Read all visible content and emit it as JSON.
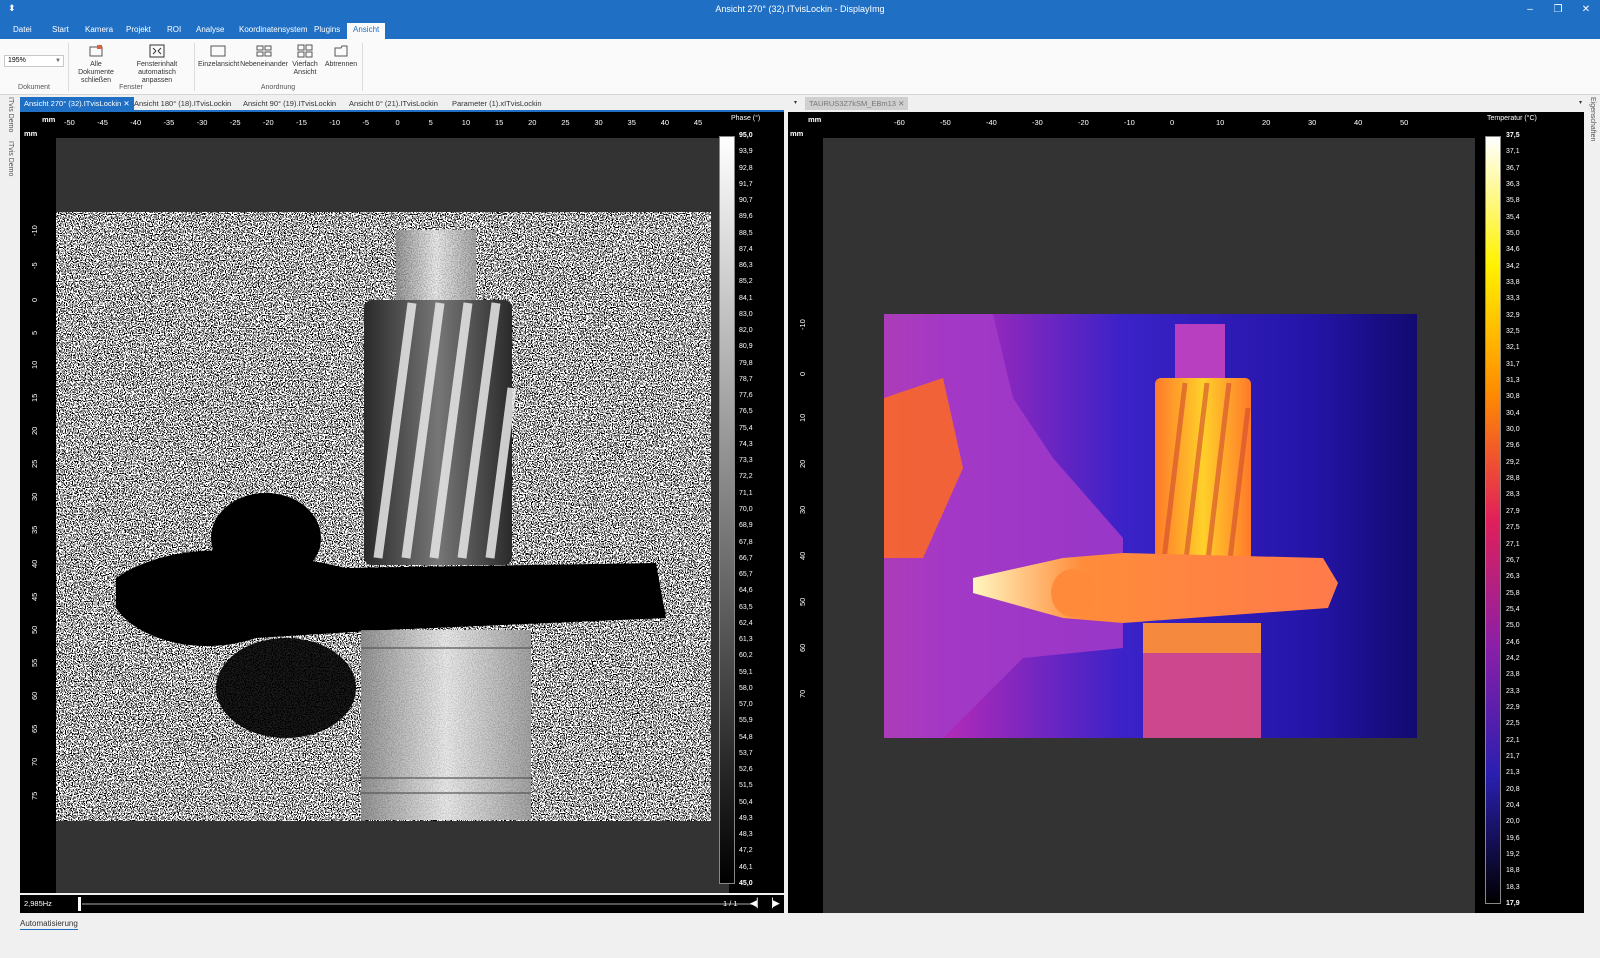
{
  "window": {
    "title": "Ansicht 270° (32).ITvisLockin - DisplayImg",
    "quick_access": "⬍",
    "buttons": {
      "minimize": "–",
      "restore": "❐",
      "close": "✕"
    }
  },
  "ribbon_tabs": [
    "Datei",
    "Start",
    "Kamera",
    "Projekt",
    "ROI",
    "Analyse",
    "Koordinatensystem",
    "Plugins",
    "Ansicht"
  ],
  "active_ribbon_tab": "Ansicht",
  "ribbon": {
    "zoom_value": "195%",
    "groups": {
      "dokument": "Dokument",
      "fenster": "Fenster",
      "anordnung": "Anordnung"
    },
    "buttons": {
      "close_all": "Alle Dokumente schließen",
      "fit_window": "Fensterinhalt automatisch anpassen",
      "single_view": "Einzelansicht",
      "side_by_side": "Nebeneinander",
      "quad_view": "Vierfach Ansicht",
      "detach": "Abtrennen"
    }
  },
  "left_strip": {
    "item1": "ITvis Demo",
    "item2": "ITvis Demo"
  },
  "right_strip": {
    "label": "Eigenschaften"
  },
  "doc_tabs_left": [
    "Ansicht 270° (32).ITvisLockin",
    "Ansicht 180° (18).ITvisLockin",
    "Ansicht 90° (19).ITvisLockin",
    "Ansicht 0° (21).ITvisLockin",
    "Parameter (1).xITvisLockin"
  ],
  "doc_tabs_right": [
    "TAURUS3Z7kSM_EBm13"
  ],
  "left_view": {
    "unit": "mm",
    "x_ticks": [
      "-50",
      "-45",
      "-40",
      "-35",
      "-30",
      "-25",
      "-20",
      "-15",
      "-10",
      "-5",
      "0",
      "5",
      "10",
      "15",
      "20",
      "25",
      "30",
      "35",
      "40",
      "45"
    ],
    "y_ticks": [
      "-10",
      "-5",
      "0",
      "5",
      "10",
      "15",
      "20",
      "25",
      "30",
      "35",
      "40",
      "45",
      "50",
      "55",
      "60",
      "65",
      "70",
      "75"
    ],
    "colorbar_title": "Phase (°)",
    "colorbar_labels": [
      "95,0",
      "93,9",
      "92,8",
      "91,7",
      "90,7",
      "89,6",
      "88,5",
      "87,4",
      "86,3",
      "85,2",
      "84,1",
      "83,0",
      "82,0",
      "80,9",
      "79,8",
      "78,7",
      "77,6",
      "76,5",
      "75,4",
      "74,3",
      "73,3",
      "72,2",
      "71,1",
      "70,0",
      "68,9",
      "67,8",
      "66,7",
      "65,7",
      "64,6",
      "63,5",
      "62,4",
      "61,3",
      "60,2",
      "59,1",
      "58,0",
      "57,0",
      "55,9",
      "54,8",
      "53,7",
      "52,6",
      "51,5",
      "50,4",
      "49,3",
      "48,3",
      "47,2",
      "46,1",
      "45,0"
    ],
    "colorbar_colors": [
      "#ffffff",
      "#000000"
    ],
    "frequency": "2,985Hz",
    "frame_counter": "1 / 1"
  },
  "right_view": {
    "unit": "mm",
    "x_ticks": [
      "-60",
      "-50",
      "-40",
      "-30",
      "-20",
      "-10",
      "0",
      "10",
      "20",
      "30",
      "40",
      "50"
    ],
    "y_ticks": [
      "-10",
      "0",
      "10",
      "20",
      "30",
      "40",
      "50",
      "60",
      "70"
    ],
    "colorbar_title": "Temperatur (°C)",
    "colorbar_labels": [
      "37,5",
      "37,1",
      "36,7",
      "36,3",
      "35,8",
      "35,4",
      "35,0",
      "34,6",
      "34,2",
      "33,8",
      "33,3",
      "32,9",
      "32,5",
      "32,1",
      "31,7",
      "31,3",
      "30,8",
      "30,4",
      "30,0",
      "29,6",
      "29,2",
      "28,8",
      "28,3",
      "27,9",
      "27,5",
      "27,1",
      "26,7",
      "26,3",
      "25,8",
      "25,4",
      "25,0",
      "24,6",
      "24,2",
      "23,8",
      "23,3",
      "22,9",
      "22,5",
      "22,1",
      "21,7",
      "21,3",
      "20,8",
      "20,4",
      "20,0",
      "19,6",
      "19,2",
      "18,8",
      "18,3",
      "17,9"
    ],
    "colorbar_colors": [
      "#ffffff",
      "#fff200",
      "#ff8c00",
      "#e0205a",
      "#8a1fa8",
      "#2a1fb0",
      "#000000"
    ]
  },
  "bottom": {
    "automation_tab": "Automatisierung"
  },
  "colors": {
    "accent": "#1f6fc5",
    "canvas": "#333333"
  }
}
